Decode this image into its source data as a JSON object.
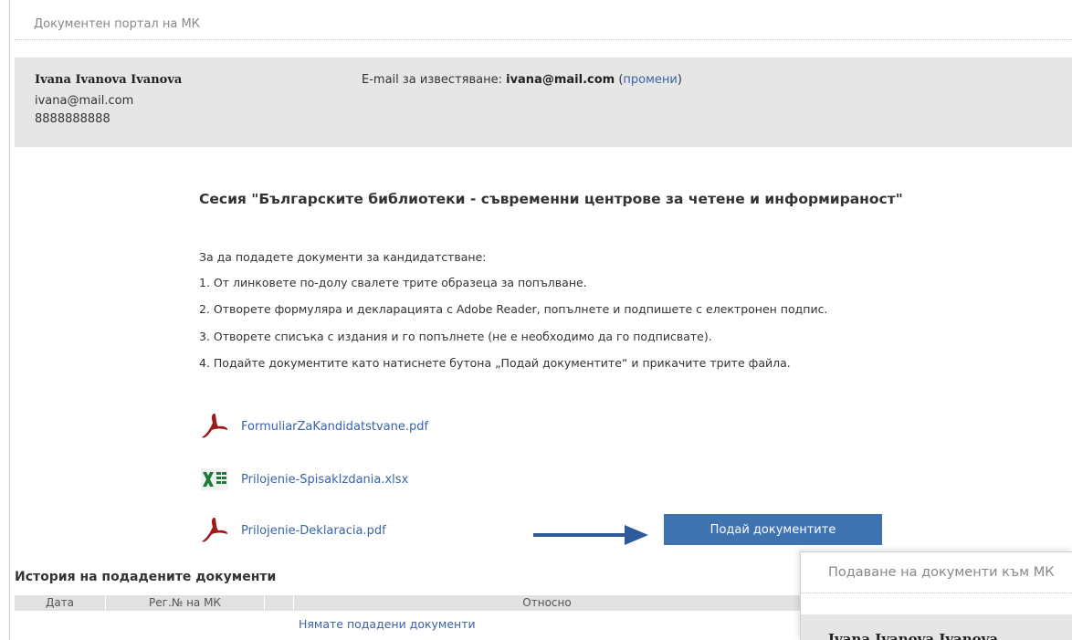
{
  "portal_title": "Документен портал на МК",
  "user": {
    "name": "Ivana Ivanova Ivanova",
    "email": "ivana@mail.com",
    "phone": "8888888888"
  },
  "notify": {
    "label": "E-mail за известяване:",
    "email": "ivana@mail.com",
    "change_link": "промени",
    "paren_open": "(",
    "paren_close": ")"
  },
  "session_title": "Сесия \"Българските библиотеки - съвременни центрове за четене и информираност\"",
  "instructions": [
    "За да подадете документи за кандидатстване:",
    "1. От линковете по-долу свалете трите образеца за попълване.",
    "2. Отворете формуляра и декларацията с Adobe Reader, попълнете и подпишете с електронен подпис.",
    "3. Отворете списъка с издания и го попълнете (не е необходимо да го подписвате).",
    "4. Подайте документите като натиснете бутона „Подай документите“ и прикачите трите файла."
  ],
  "files": [
    {
      "name": "FormuliarZaKandidatstvane.pdf",
      "icon": "pdf-icon"
    },
    {
      "name": "Prilojenie-SpisakIzdania.xlsx",
      "icon": "excel-icon"
    },
    {
      "name": "Prilojenie-Deklaracia.pdf",
      "icon": "pdf-icon"
    }
  ],
  "submit_button": "Подай документите",
  "history": {
    "title": "История на подадените документи",
    "columns": [
      "Дата",
      "Рег.№ на МК",
      "",
      "Относно"
    ],
    "empty": "Нямате подадени документи"
  },
  "overlay": {
    "title": "Подаване на документи към МК",
    "name": "Ivana Ivanova Ivanova"
  },
  "colors": {
    "accent": "#3e73b0",
    "link": "#3a63a8",
    "panel": "#e6e6e6",
    "arrow": "#2e5a9c",
    "pdf": "#a01818",
    "excel": "#1e7a3a"
  }
}
